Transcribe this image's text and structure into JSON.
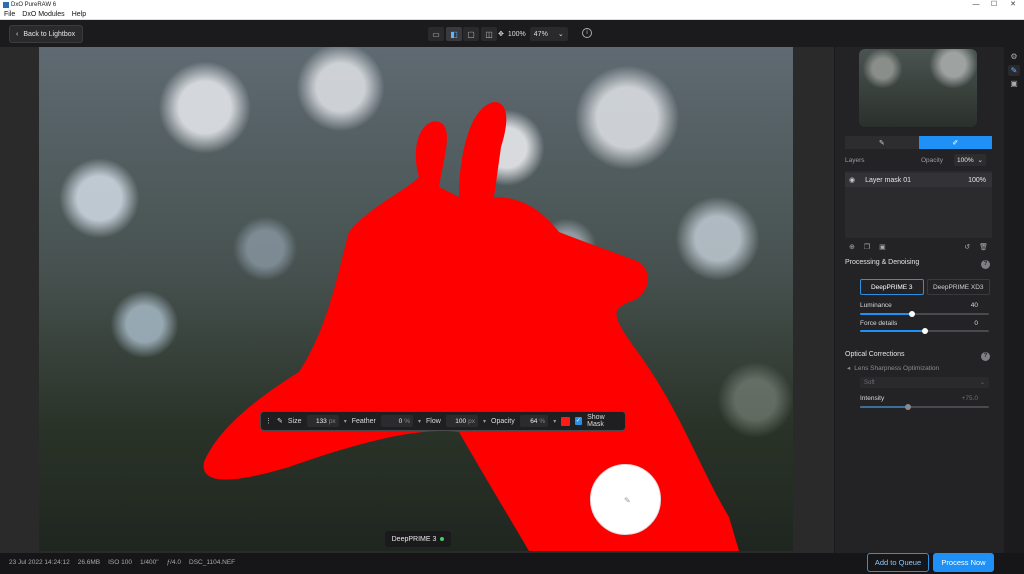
{
  "window": {
    "title": "DxO PureRAW 6",
    "controls": {
      "minimize": "—",
      "maximize": "☐",
      "close": "✕"
    }
  },
  "menu": [
    "File",
    "DxO Modules",
    "Help"
  ],
  "toolbar": {
    "back_label": "Back to Lightbox",
    "zoom_fit": "100%",
    "zoom_value": "47%"
  },
  "brush_toolbar": {
    "size_label": "Size",
    "size_value": "133",
    "size_unit": "px",
    "feather_label": "Feather",
    "feather_value": "0",
    "feather_unit": "%",
    "flow_label": "Flow",
    "flow_value": "100",
    "flow_unit": "px",
    "opacity_label": "Opacity",
    "opacity_value": "64",
    "opacity_unit": "%",
    "mask_color": "#ff1a1a",
    "show_mask_label": "Show Mask",
    "show_mask_checked": true
  },
  "processing_badge": "DeepPRIME 3",
  "status": {
    "date": "23 Jul 2022 14:24:12",
    "size": "26.6MB",
    "iso": "ISO 100",
    "shutter": "1/400\"",
    "aperture": "ƒ/4.0",
    "filename": "DSC_1104.NEF"
  },
  "actions": {
    "queue": "Add to Queue",
    "process": "Process Now"
  },
  "panel": {
    "layers_label": "Layers",
    "opacity_label": "Opacity",
    "opacity_value": "100%",
    "layer": {
      "name": "Layer mask 01",
      "opacity": "100%"
    },
    "processing": {
      "title": "Processing & Denoising",
      "modes": [
        "DeepPRIME 3",
        "DeepPRIME XD3"
      ],
      "selected_mode": "DeepPRIME 3",
      "luminance_label": "Luminance",
      "luminance_value": "40",
      "luminance_level": 0.4,
      "force_label": "Force details",
      "force_value": "0",
      "force_level": 0.5
    },
    "optical": {
      "title": "Optical Corrections",
      "lens_label": "Lens Sharpness Optimization",
      "lens_dropdown": "Soft",
      "intensity_label": "Intensity",
      "intensity_value": "+75.0",
      "intensity_level": 0.375
    }
  },
  "colors": {
    "accent": "#1f90f5",
    "mask": "#ff1a1a",
    "status_ok": "#3fd05a"
  }
}
